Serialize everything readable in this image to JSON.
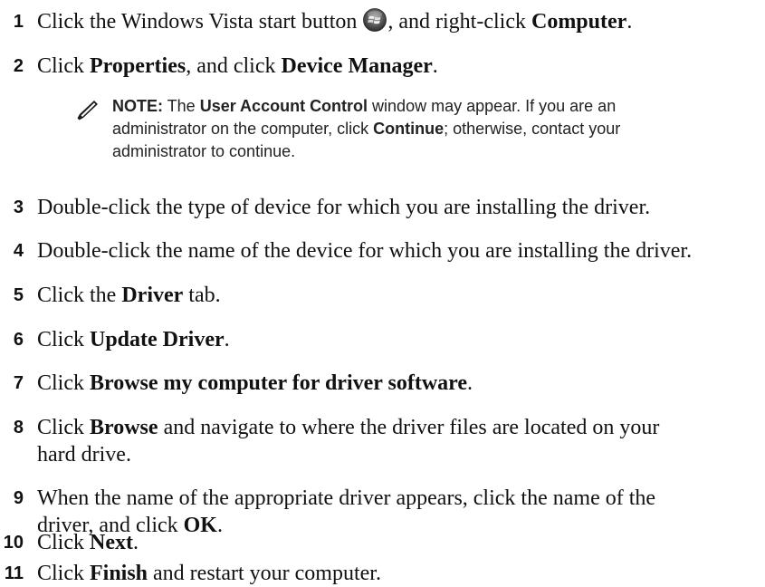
{
  "steps": [
    {
      "num": "1",
      "parts": [
        "Click the Windows Vista start button ",
        "",
        ", and right-click ",
        "Computer",
        "."
      ]
    },
    {
      "num": "2",
      "parts": [
        "Click ",
        "Properties",
        ", and click ",
        "Device Manager",
        "."
      ]
    },
    {
      "num": "3",
      "parts": [
        "Double-click the type of device for which you are installing the driver."
      ]
    },
    {
      "num": "4",
      "parts": [
        "Double-click the name of the device for which you are installing the driver."
      ]
    },
    {
      "num": "5",
      "parts": [
        "Click the ",
        "Driver",
        " tab."
      ]
    },
    {
      "num": "6",
      "parts": [
        "Click ",
        "Update Driver",
        "."
      ]
    },
    {
      "num": "7",
      "parts": [
        "Click ",
        "Browse my computer for driver software",
        "."
      ]
    },
    {
      "num": "8",
      "lines": [
        "Click ",
        "Browse",
        " and navigate to where the driver files are located on your",
        "hard drive."
      ]
    },
    {
      "num": "9",
      "lines": [
        "When the name of the appropriate driver appears, click the name of the",
        "driver, and click ",
        "OK",
        "."
      ]
    },
    {
      "num": "10",
      "parts": [
        "Click ",
        "Next",
        "."
      ]
    },
    {
      "num": "11",
      "parts": [
        "Click ",
        "Finish",
        " and restart your computer."
      ]
    }
  ],
  "note": {
    "label": "NOTE:",
    "line1_a": " The ",
    "line1_b": "User Account Control",
    "line1_c": " window may appear. If you are an",
    "line2_a": "administrator on the computer, click ",
    "line2_b": "Continue",
    "line2_c": "; otherwise, contact your",
    "line3": "administrator to continue."
  },
  "icons": {
    "start_button": "windows-vista-start-orb-icon",
    "note": "note-pencil-icon"
  }
}
